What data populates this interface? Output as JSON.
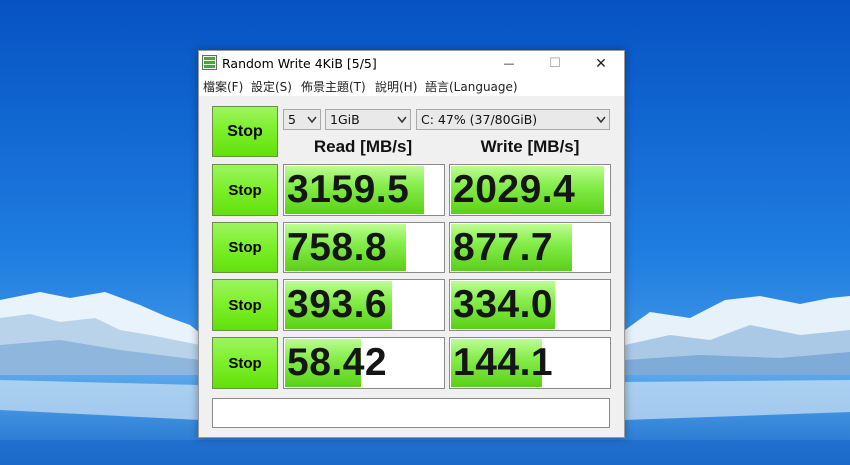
{
  "window": {
    "title": "Random Write 4KiB [5/5]",
    "minimize_glyph": "—",
    "maximize_glyph": "☐",
    "close_glyph": "✕"
  },
  "menu": [
    "檔案(F)",
    "設定(S)",
    "佈景主題(T)",
    "說明(H)",
    "語言(Language)"
  ],
  "controls": {
    "count": "5",
    "size": "1GiB",
    "drive": "C: 47% (37/80GiB)",
    "all_button": "Stop"
  },
  "columns": {
    "read": "Read [MB/s]",
    "write": "Write [MB/s]"
  },
  "rows": [
    {
      "button": "Stop",
      "read": "3159.5",
      "write": "2029.4",
      "read_fill": 0.88,
      "write_fill": 0.97
    },
    {
      "button": "Stop",
      "read": "758.8",
      "write": "877.7",
      "read_fill": 0.77,
      "write_fill": 0.77
    },
    {
      "button": "Stop",
      "read": "393.6",
      "write": "334.0",
      "read_fill": 0.68,
      "write_fill": 0.66
    },
    {
      "button": "Stop",
      "read": "58.42",
      "write": "144.1",
      "read_fill": 0.49,
      "write_fill": 0.58
    }
  ],
  "comment": "",
  "colors": {
    "button_green": "#7ef02c",
    "bar_green": "#86ee4c",
    "sky_top": "#0a5fcf",
    "sky_bottom": "#3d9be8",
    "water": "#2f86db"
  }
}
